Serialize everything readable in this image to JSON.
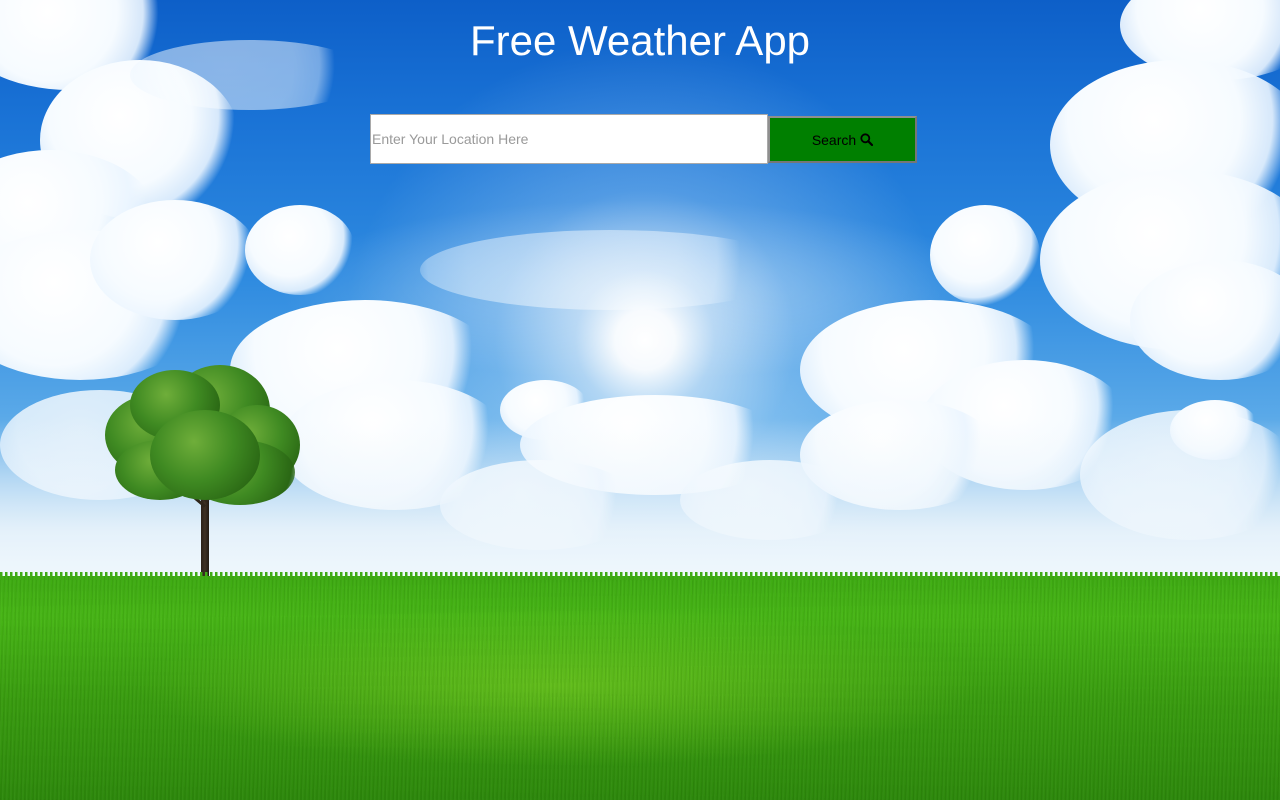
{
  "app": {
    "title": "Free Weather App"
  },
  "search": {
    "placeholder": "Enter Your Location Here",
    "value": "",
    "button_label": "Search",
    "button_icon": "search-icon",
    "button_color": "#007f00"
  },
  "background": {
    "description_icon": "sky-grass-tree-background",
    "sky_color": "#1a73d6",
    "grass_color": "#3fae12"
  }
}
